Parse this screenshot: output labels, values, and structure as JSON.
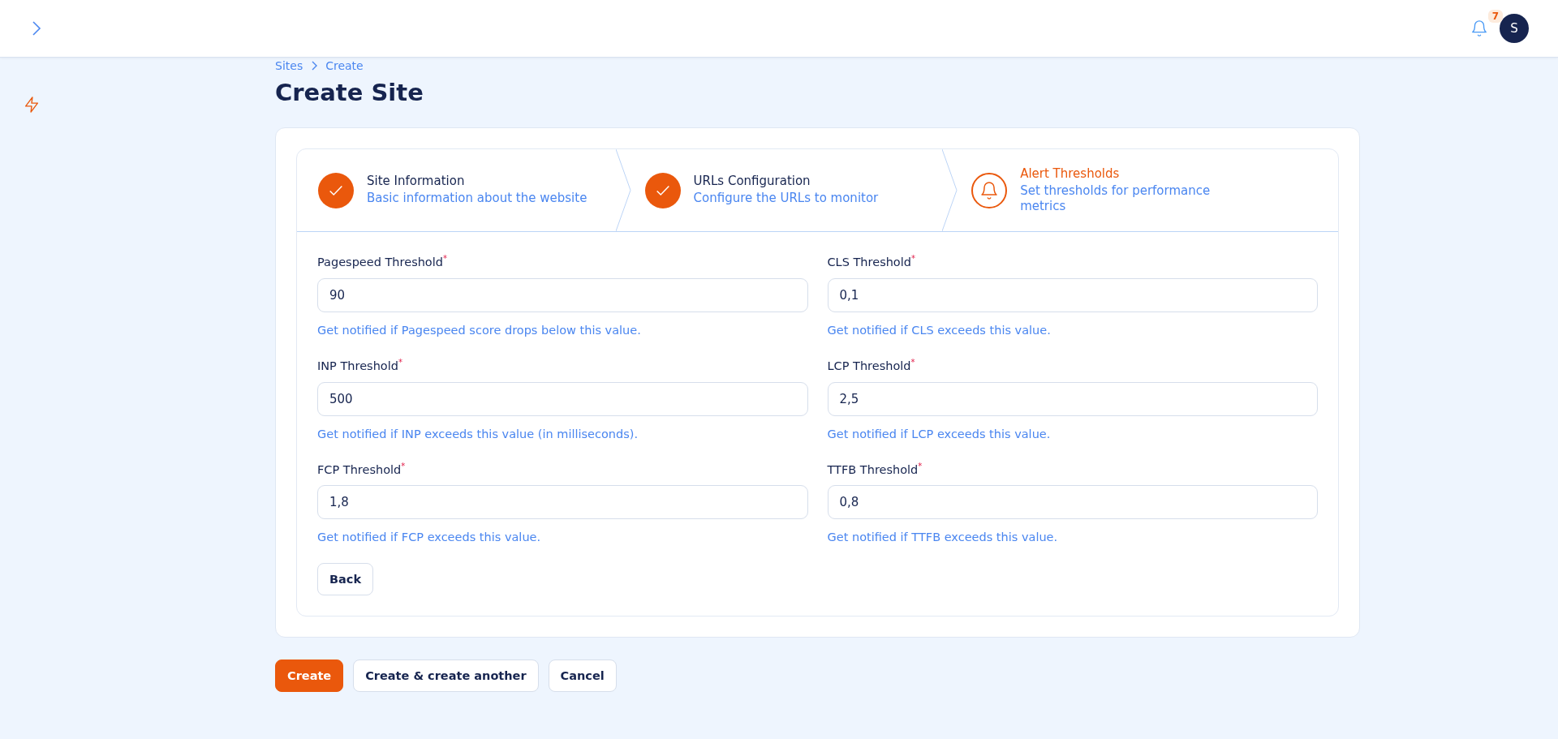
{
  "topbar": {
    "notification_count": "7",
    "avatar_initial": "S"
  },
  "breadcrumbs": [
    {
      "label": "Sites"
    },
    {
      "label": "Create"
    }
  ],
  "title": "Create Site",
  "steps": [
    {
      "title": "Site Information",
      "description": "Basic information about the website",
      "completed": true
    },
    {
      "title": "URLs Configuration",
      "description": "Configure the URLs to monitor",
      "completed": true
    },
    {
      "title": "Alert Thresholds",
      "description": "Set thresholds for performance metrics",
      "completed": false
    }
  ],
  "fields": [
    {
      "label": "Pagespeed Threshold",
      "required_mark": "*",
      "value": "90",
      "hint": "Get notified if Pagespeed score drops below this value."
    },
    {
      "label": "CLS Threshold",
      "required_mark": "*",
      "value": "0,1",
      "hint": "Get notified if CLS exceeds this value."
    },
    {
      "label": "INP Threshold",
      "required_mark": "*",
      "value": "500",
      "hint": "Get notified if INP exceeds this value (in milliseconds)."
    },
    {
      "label": "LCP Threshold",
      "required_mark": "*",
      "value": "2,5",
      "hint": "Get notified if LCP exceeds this value."
    },
    {
      "label": "FCP Threshold",
      "required_mark": "*",
      "value": "1,8",
      "hint": "Get notified if FCP exceeds this value."
    },
    {
      "label": "TTFB Threshold",
      "required_mark": "*",
      "value": "0,8",
      "hint": "Get notified if TTFB exceeds this value."
    }
  ],
  "back_button": "Back",
  "actions": [
    {
      "label": "Create",
      "kind": "primary"
    },
    {
      "label": "Create & create another",
      "kind": "secondary"
    },
    {
      "label": "Cancel",
      "kind": "secondary"
    }
  ]
}
